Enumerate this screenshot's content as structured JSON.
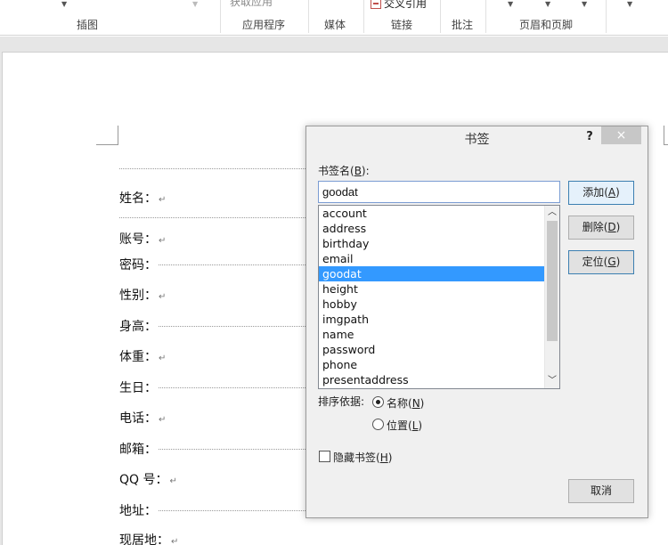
{
  "ribbon": {
    "groups": [
      "插图",
      "应用程序",
      "媒体",
      "链接",
      "批注",
      "页眉和页脚"
    ],
    "top_partial": "获取应用",
    "cross_ref_label": "交叉引用"
  },
  "document": {
    "lines": [
      "姓名：",
      "账号：",
      "密码：",
      "性别：",
      "身高：",
      "体重：",
      "生日：",
      "电话：",
      "邮箱：",
      "QQ 号：",
      "地址：",
      "现居地："
    ],
    "paragraph_mark": "↵"
  },
  "dialog": {
    "title": "书签",
    "help": "?",
    "close": "×",
    "name_label": "书签名(",
    "name_key": "B",
    "name_label_end": "):",
    "name_value": "goodat",
    "bookmarks": [
      "account",
      "address",
      "birthday",
      "email",
      "goodat",
      "height",
      "hobby",
      "imgpath",
      "name",
      "password",
      "phone",
      "presentaddress"
    ],
    "selected": "goodat",
    "add_label": "添加(",
    "add_key": "A",
    "delete_label": "删除(",
    "delete_key": "D",
    "goto_label": "定位(",
    "goto_key": "G",
    "paren_close": ")",
    "sort_label": "排序依据:",
    "sort_name": "名称(",
    "sort_name_key": "N",
    "sort_location": "位置(",
    "sort_location_key": "L",
    "hidden_label": "隐藏书签(",
    "hidden_key": "H",
    "cancel_label": "取消",
    "sort_by": "name",
    "hidden_checked": false
  }
}
